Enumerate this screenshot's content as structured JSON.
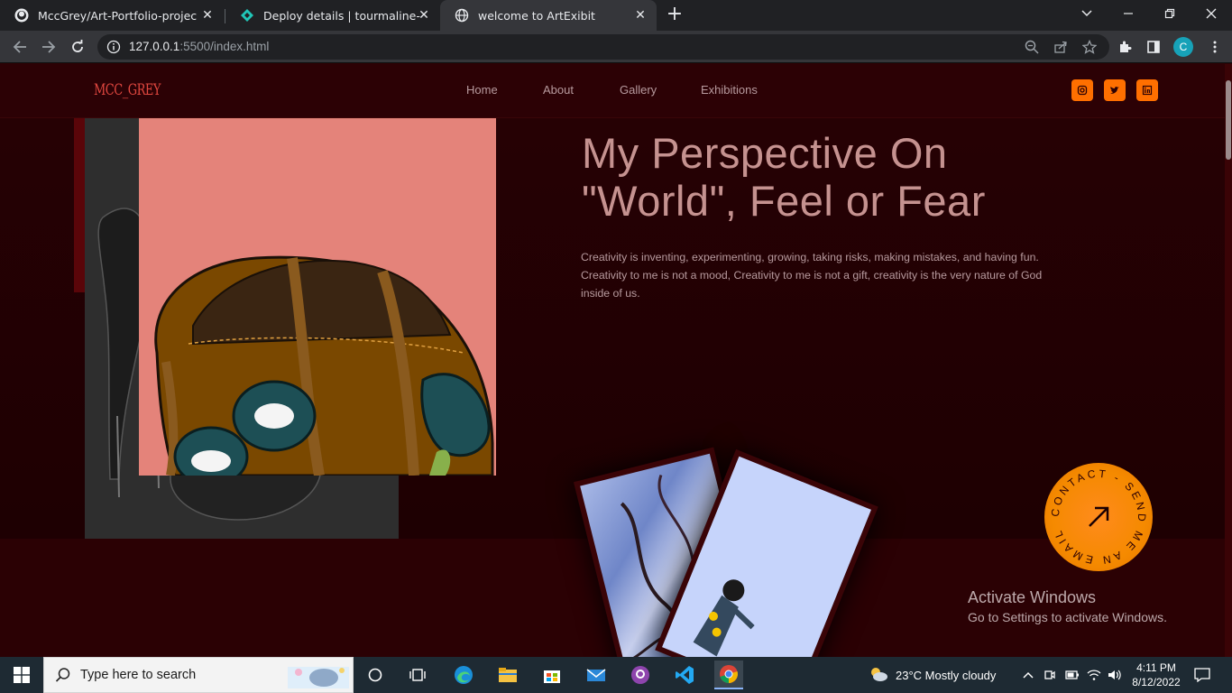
{
  "browser": {
    "tabs": [
      {
        "title": "MccGrey/Art-Portfolio-project: th",
        "icon": "github-icon",
        "active": false
      },
      {
        "title": "Deploy details | tourmaline-bunn",
        "icon": "netlify-icon",
        "active": false
      },
      {
        "title": "welcome to ArtExibit",
        "icon": "globe-icon",
        "active": true
      }
    ],
    "close_glyph": "✕",
    "new_tab_glyph": "+",
    "url_host": "127.0.0.1",
    "url_path": ":5500/index.html",
    "profile_initial": "C"
  },
  "site": {
    "logo": "MCC_GREY",
    "nav": [
      "Home",
      "About",
      "Gallery",
      "Exhibitions"
    ],
    "social": [
      "instagram-icon",
      "twitter-icon",
      "linkedin-icon"
    ],
    "hero_title_line1": "My Perspective On",
    "hero_title_line2": "\"World\", Feel or Fear",
    "hero_text": "Creativity is inventing, experimenting, growing, taking risks, making mistakes, and having fun. Creativity to me is not a mood, Creativity to me is not a gift, creativity is the very nature of God inside of us.",
    "contact_ring_text": "CONTACT - SEND ME AN EMAIL",
    "accent_color": "#ff6f00",
    "background_color": "#2b0204"
  },
  "watermark": {
    "line1": "Activate Windows",
    "line2": "Go to Settings to activate Windows."
  },
  "taskbar": {
    "search_placeholder": "Type here to search",
    "weather": "23°C  Mostly cloudy",
    "time": "4:11 PM",
    "date": "8/12/2022"
  }
}
